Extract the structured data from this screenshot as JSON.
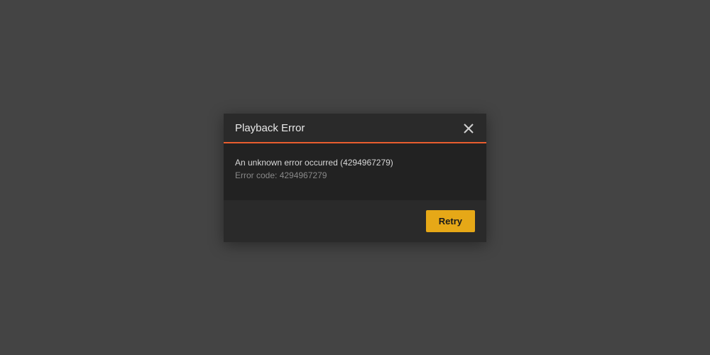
{
  "dialog": {
    "title": "Playback Error",
    "message": "An unknown error occurred (4294967279)",
    "error_code_label": "Error code: 4294967279",
    "retry_label": "Retry"
  }
}
